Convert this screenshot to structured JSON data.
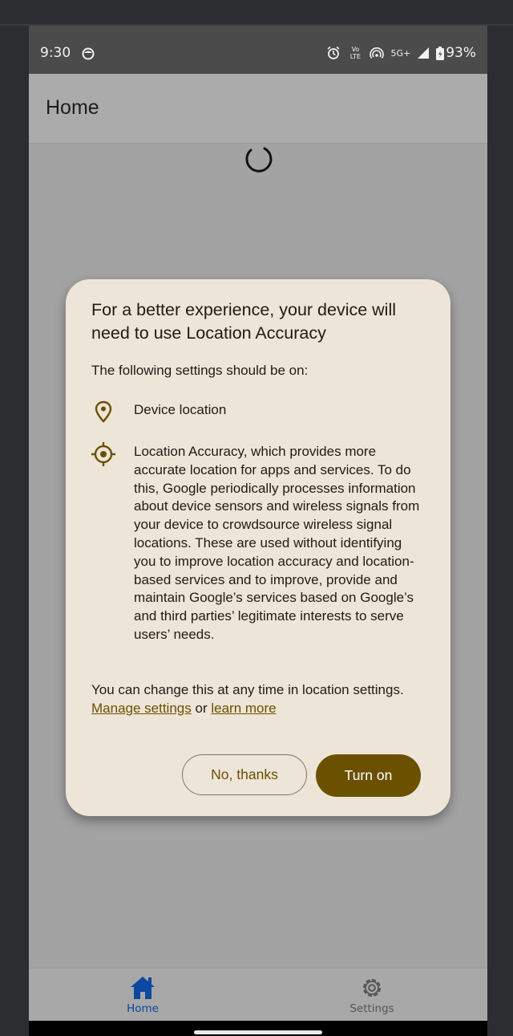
{
  "status_bar": {
    "time": "9:30",
    "network": "5G+",
    "volte": "Vo LTE",
    "battery": "93%"
  },
  "app_bar": {
    "title": "Home"
  },
  "dialog": {
    "title": "For a better experience, your device will need to use Location Accuracy",
    "intro": "The following settings should be on:",
    "items": [
      {
        "icon": "location-pin-icon",
        "text": "Device location"
      },
      {
        "icon": "gps-target-icon",
        "text": "Location Accuracy, which provides more accurate location for apps and services. To do this, Google periodically processes information about device sensors and wireless signals from your device to crowdsource wireless signal locations. These are used without identifying you to improve location accuracy and location-based services and to improve, provide and maintain Google’s services based on Google’s and third parties’ legitimate interests to serve users’ needs."
      }
    ],
    "footer_prefix": "You can change this at any time in location settings.",
    "manage_link": "Manage settings",
    "or_text": "or",
    "learn_link": "learn more",
    "cancel_label": "No, thanks",
    "confirm_label": "Turn on"
  },
  "bottom_nav": {
    "items": [
      {
        "label": "Home",
        "icon": "home-icon",
        "active": true
      },
      {
        "label": "Settings",
        "icon": "gear-icon",
        "active": false
      }
    ]
  },
  "colors": {
    "accent": "#6b5000",
    "dialog_bg": "#ede5d7",
    "nav_active": "#0d47a1",
    "nav_inactive": "#555555"
  }
}
